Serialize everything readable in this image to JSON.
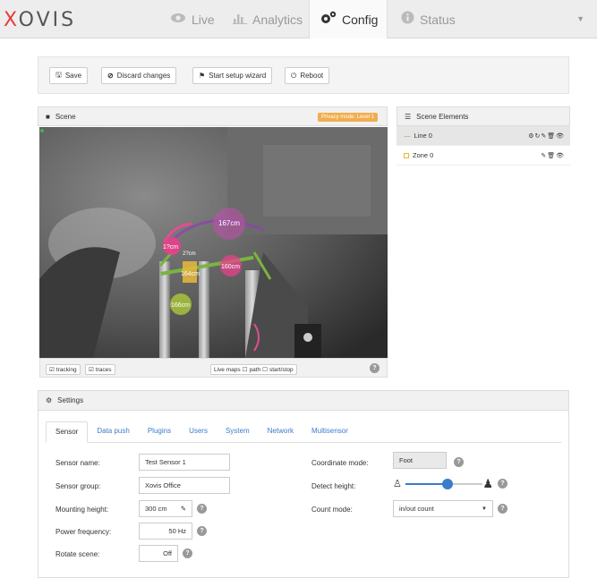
{
  "brand": "XOVIS",
  "nav": {
    "tabs": [
      {
        "label": "Live",
        "icon": "eye-icon"
      },
      {
        "label": "Analytics",
        "icon": "bar-chart-icon"
      },
      {
        "label": "Config",
        "icon": "gears-icon"
      },
      {
        "label": "Status",
        "icon": "info-icon"
      }
    ],
    "active": "Config"
  },
  "toolbar": {
    "save": "Save",
    "discard": "Discard changes",
    "wizard": "Start setup wizard",
    "reboot": "Reboot"
  },
  "scene": {
    "title": "Scene",
    "privacy_badge": "Privacy mode: Level 1",
    "footer": {
      "tracking": "tracking",
      "traces": "traces",
      "live_maps": "Live maps",
      "path": "path",
      "startstop": "start/stop"
    },
    "overlay_labels": [
      "167cm",
      "1?cm",
      "160cm",
      "164cm",
      "166cm",
      "2?cm"
    ]
  },
  "elements": {
    "title": "Scene Elements",
    "items": [
      {
        "name": "Line 0",
        "tools": "⚙↻✎🗑👁"
      },
      {
        "name": "Zone 0",
        "tools": "✎🗑👁"
      }
    ]
  },
  "settings": {
    "title": "Settings",
    "tabs": [
      "Sensor",
      "Data push",
      "Plugins",
      "Users",
      "System",
      "Network",
      "Multisensor"
    ],
    "active_tab": "Sensor",
    "sensor_name_label": "Sensor name:",
    "sensor_name": "Test Sensor 1",
    "sensor_group_label": "Sensor group:",
    "sensor_group": "Xovis Office",
    "mounting_height_label": "Mounting height:",
    "mounting_height": "300 cm",
    "power_frequency_label": "Power frequency:",
    "power_frequency": "50 Hz",
    "rotate_scene_label": "Rotate scene:",
    "rotate_scene": "Off",
    "coordinate_mode_label": "Coordinate mode:",
    "coordinate_mode": "Foot",
    "detect_height_label": "Detect height:",
    "detect_height_level": 0.55,
    "count_mode_label": "Count mode:",
    "count_mode": "in/out count"
  }
}
